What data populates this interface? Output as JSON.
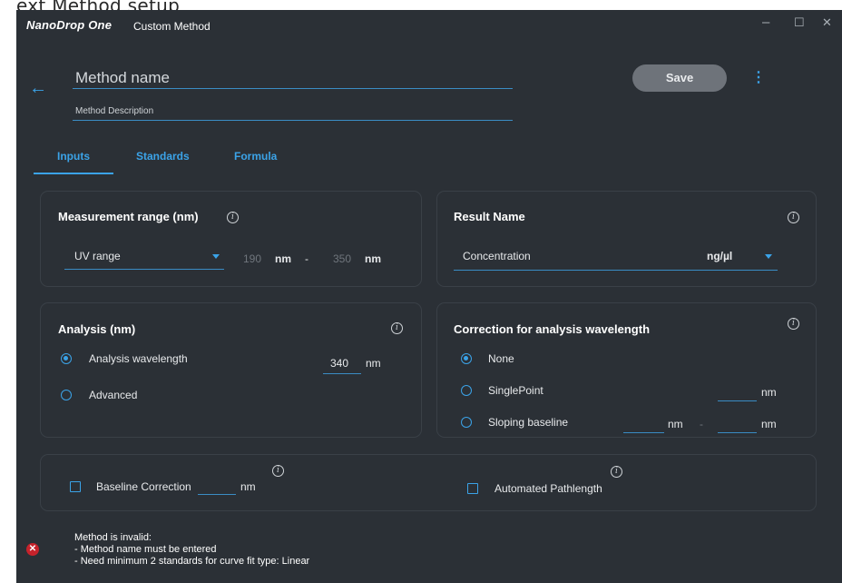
{
  "caption": "ext Method setup",
  "app": {
    "brand": "NanoDrop One",
    "window_title": "Custom Method",
    "window_controls": {
      "minimize": "–",
      "maximize": "☐",
      "close": "✕"
    }
  },
  "header": {
    "back_icon": "arrow-left-icon",
    "method_name_placeholder": "Method name",
    "method_description_placeholder": "Method Description",
    "save_label": "Save",
    "more_icon": "vertical-ellipsis-icon"
  },
  "tabs": [
    {
      "label": "Inputs",
      "active": true
    },
    {
      "label": "Standards",
      "active": false
    },
    {
      "label": "Formula",
      "active": false
    }
  ],
  "measurement_range": {
    "title": "Measurement range (nm)",
    "range_selected": "UV range",
    "start_value": "190",
    "start_unit": "nm",
    "separator": "-",
    "end_value": "350",
    "end_unit": "nm"
  },
  "result_name": {
    "title": "Result Name",
    "value": "Concentration",
    "unit_selected": "ng/µl"
  },
  "analysis": {
    "title": "Analysis (nm)",
    "options": [
      {
        "label": "Analysis wavelength",
        "selected": true
      },
      {
        "label": "Advanced",
        "selected": false
      }
    ],
    "wavelength_value": "340",
    "wavelength_unit": "nm"
  },
  "correction": {
    "title": "Correction for analysis wavelength",
    "options": [
      {
        "label": "None",
        "selected": true
      },
      {
        "label": "SinglePoint",
        "selected": false
      },
      {
        "label": "Sloping baseline",
        "selected": false
      }
    ],
    "single_point_unit": "nm",
    "sloping_start_unit": "nm",
    "sloping_separator": "-",
    "sloping_end_unit": "nm"
  },
  "options_row": {
    "baseline_label": "Baseline Correction",
    "baseline_unit": "nm",
    "pathlength_label": "Automated Pathlength"
  },
  "error": {
    "icon": "error-x-icon",
    "title": "Method is invalid:",
    "messages": [
      "- Method name must be entered",
      "- Need minimum 2 standards for curve fit type: Linear"
    ]
  },
  "colors": {
    "background": "#2b3036",
    "accent": "#3ba3e8",
    "error": "#c6222b",
    "save_disabled": "#6e737a"
  }
}
